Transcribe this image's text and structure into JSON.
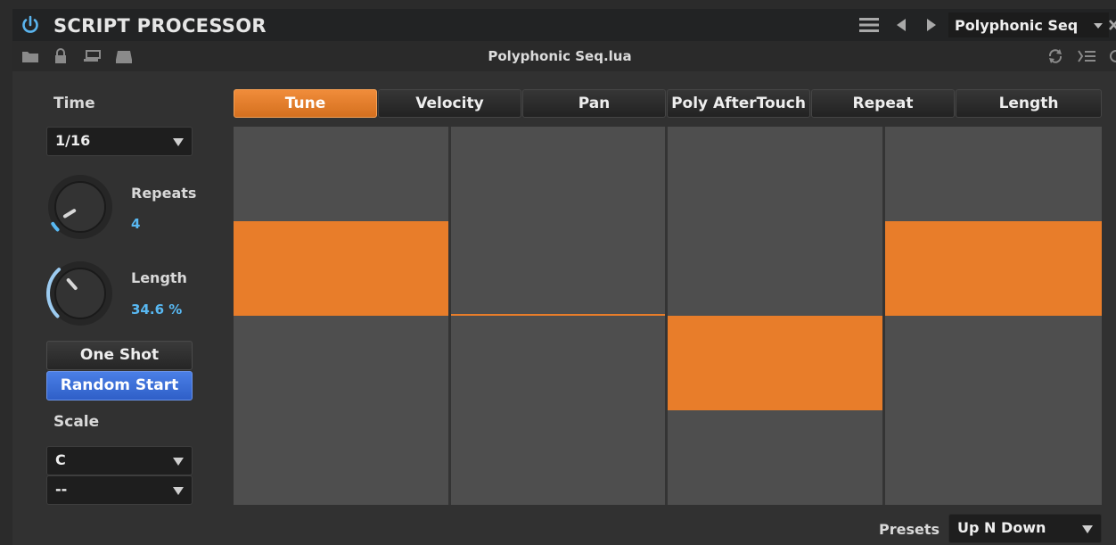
{
  "header": {
    "title": "SCRIPT PROCESSOR",
    "preset_name": "Polyphonic Seq"
  },
  "toolbar": {
    "filename": "Polyphonic Seq.lua",
    "icons": [
      "folder-icon",
      "lock-icon",
      "window-icon",
      "drive-icon",
      "refresh-icon",
      "list-icon"
    ]
  },
  "left_panel": {
    "time_label": "Time",
    "time_value": "1/16",
    "repeats_label": "Repeats",
    "repeats_value": "4",
    "repeats_knob_fraction": 0.05,
    "length_label": "Length",
    "length_value": "34.6 %",
    "length_knob_fraction": 0.346,
    "one_shot_label": "One Shot",
    "random_start_label": "Random Start",
    "scale_label": "Scale",
    "scale_root": "C",
    "scale_type": "--"
  },
  "tabs": [
    {
      "label": "Tune",
      "active": true
    },
    {
      "label": "Velocity",
      "active": false
    },
    {
      "label": "Pan",
      "active": false
    },
    {
      "label": "Poly AfterTouch",
      "active": false
    },
    {
      "label": "Repeat",
      "active": false
    },
    {
      "label": "Length",
      "active": false
    }
  ],
  "steps": [
    {
      "value": 0.5
    },
    {
      "value": 0.0
    },
    {
      "value": -0.5
    },
    {
      "value": 0.5
    }
  ],
  "footer": {
    "presets_label": "Presets",
    "presets_value": "Up N Down"
  },
  "colors": {
    "accent_orange": "#e87d2a",
    "accent_blue": "#58b8f2",
    "button_blue": "#3a6bd6"
  }
}
